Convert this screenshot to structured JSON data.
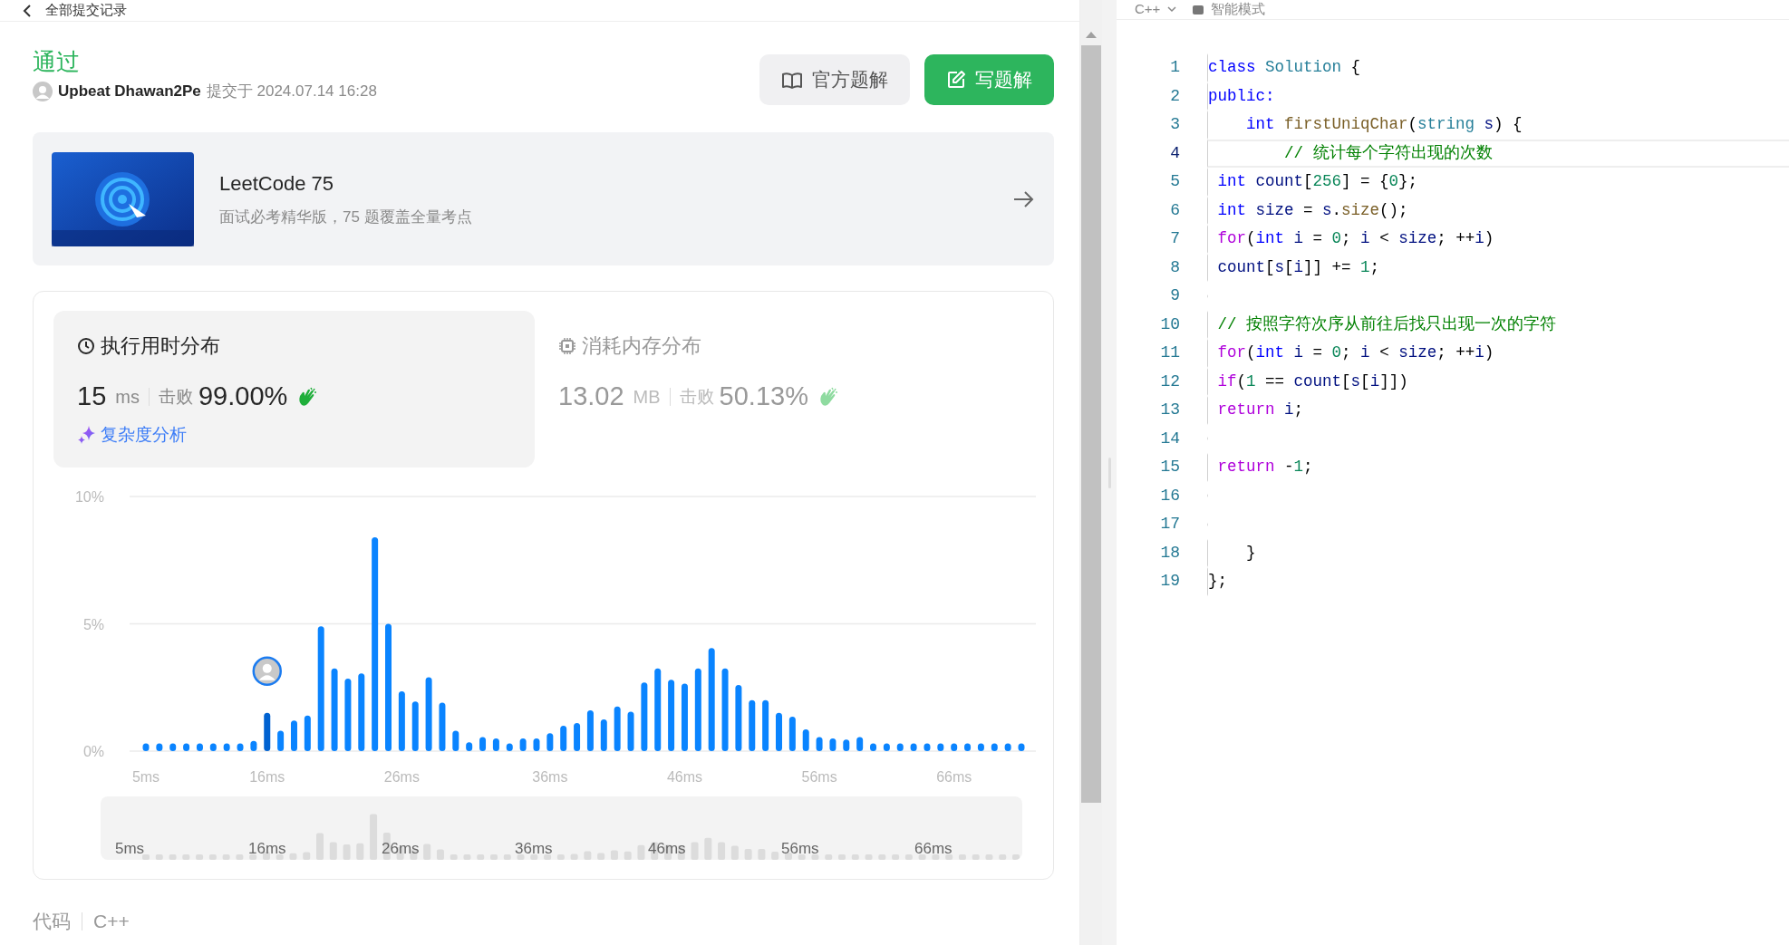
{
  "header": {
    "back_label": "全部提交记录"
  },
  "submission": {
    "status": "通过",
    "user": "Upbeat Dhawan2Pe",
    "submitted_label": "提交于 2024.07.14 16:28"
  },
  "buttons": [
    {
      "label": "官方题解",
      "kind": "secondary"
    },
    {
      "label": "写题解",
      "kind": "primary"
    }
  ],
  "study_plan": {
    "title": "LeetCode 75",
    "subtitle": "面试必考精华版，75 题覆盖全量考点"
  },
  "stats_tabs": [
    {
      "kind": "time",
      "title": "执行用时分布",
      "value": "15",
      "unit": "ms",
      "beats_label": "击败",
      "beats": "99.00%",
      "selected": true
    },
    {
      "kind": "memory",
      "title": "消耗内存分布",
      "value": "13.02",
      "unit": "MB",
      "beats_label": "击败",
      "beats": "50.13%",
      "selected": false
    }
  ],
  "analysis_link": "复杂度分析",
  "chart_data": {
    "type": "bar",
    "stacked": true,
    "categories": [
      "5ms",
      null,
      null,
      null,
      null,
      null,
      null,
      null,
      null,
      "16ms",
      null,
      null,
      null,
      null,
      null,
      null,
      null,
      null,
      null,
      "26ms",
      null,
      null,
      null,
      null,
      null,
      null,
      null,
      null,
      null,
      null,
      "36ms",
      null,
      null,
      null,
      null,
      null,
      null,
      null,
      null,
      null,
      "46ms",
      null,
      null,
      null,
      null,
      null,
      null,
      null,
      null,
      null,
      "56ms",
      null,
      null,
      null,
      null,
      null,
      null,
      null,
      null,
      null,
      "66ms",
      null,
      null,
      null,
      null,
      null
    ],
    "series": [
      {
        "color": "#0062d1",
        "values": [
          null,
          null,
          null,
          null,
          null,
          null,
          null,
          null,
          null,
          1.5,
          null,
          null,
          null,
          null,
          null,
          null,
          null,
          null,
          null,
          null,
          null,
          null,
          null,
          null,
          null,
          null,
          null,
          null,
          null,
          null,
          null,
          null,
          null,
          null,
          null,
          null,
          null,
          null,
          null,
          null,
          null,
          null,
          null,
          null,
          null,
          null,
          null,
          null,
          null,
          null,
          null,
          null,
          null,
          null,
          null,
          null,
          null,
          null,
          null,
          null,
          null,
          null,
          null,
          null,
          null,
          null
        ]
      },
      {
        "color": "#0a84ff",
        "values": [
          0.3,
          0.3,
          0.3,
          0.3,
          0.3,
          0.3,
          0.3,
          0.3,
          0.4,
          null,
          0.8,
          1.2,
          1.4,
          4.9,
          3.25,
          2.85,
          3.05,
          8.4,
          5.0,
          2.35,
          1.95,
          2.9,
          1.9,
          0.8,
          0.35,
          0.55,
          0.5,
          0.3,
          0.5,
          0.5,
          0.7,
          1.0,
          1.1,
          1.6,
          1.25,
          1.75,
          1.55,
          2.7,
          3.25,
          2.8,
          2.65,
          3.25,
          4.05,
          3.25,
          2.6,
          2.0,
          2.0,
          1.5,
          1.35,
          0.85,
          0.55,
          0.5,
          0.45,
          0.55,
          0.3,
          0.3,
          0.3,
          0.3,
          0.3,
          0.3,
          0.3,
          0.3,
          0.3,
          0.3,
          0.3,
          0.3
        ]
      }
    ],
    "ylim": [
      0,
      10
    ],
    "yticks": [
      {
        "value": 0,
        "label": "0%"
      },
      {
        "value": 5,
        "label": "5%"
      },
      {
        "value": 10,
        "label": "10%"
      }
    ]
  },
  "overview_labels": [
    "5ms",
    "16ms",
    "26ms",
    "36ms",
    "46ms",
    "56ms",
    "66ms"
  ],
  "code_section": {
    "label": "代码",
    "language": "C++"
  },
  "editor": {
    "language": "C++",
    "mode": "智能模式",
    "lines": [
      {
        "number": "1",
        "current": false,
        "tokens": [
          {
            "text": "class ",
            "kind": "kw"
          },
          {
            "text": "Solution",
            "kind": "type"
          },
          {
            "text": " {",
            "kind": "plain"
          }
        ]
      },
      {
        "number": "2",
        "current": false,
        "tokens": [
          {
            "text": "public:",
            "kind": "kw"
          }
        ]
      },
      {
        "number": "3",
        "current": false,
        "tokens": [
          {
            "text": "    int ",
            "kind": "kw"
          },
          {
            "text": "firstUniqChar",
            "kind": "func"
          },
          {
            "text": "(",
            "kind": "plain"
          },
          {
            "text": "string",
            "kind": "type"
          },
          {
            "text": " s",
            "kind": "var"
          },
          {
            "text": ") {",
            "kind": "plain"
          }
        ]
      },
      {
        "number": "4",
        "current": true,
        "tokens": [
          {
            "text": "        // 统计每个字符出现的次数",
            "kind": "comment"
          }
        ]
      },
      {
        "number": "5",
        "current": false,
        "tokens": [
          {
            "text": " int ",
            "kind": "kw"
          },
          {
            "text": "count",
            "kind": "var"
          },
          {
            "text": "[",
            "kind": "plain"
          },
          {
            "text": "256",
            "kind": "num"
          },
          {
            "text": "] = {",
            "kind": "plain"
          },
          {
            "text": "0",
            "kind": "num"
          },
          {
            "text": "};",
            "kind": "plain"
          }
        ]
      },
      {
        "number": "6",
        "current": false,
        "tokens": [
          {
            "text": " int ",
            "kind": "kw"
          },
          {
            "text": "size",
            "kind": "var"
          },
          {
            "text": " = ",
            "kind": "plain"
          },
          {
            "text": "s",
            "kind": "var"
          },
          {
            "text": ".",
            "kind": "plain"
          },
          {
            "text": "size",
            "kind": "func"
          },
          {
            "text": "();",
            "kind": "plain"
          }
        ]
      },
      {
        "number": "7",
        "current": false,
        "tokens": [
          {
            "text": " for",
            "kind": "ctrl"
          },
          {
            "text": "(",
            "kind": "plain"
          },
          {
            "text": "int ",
            "kind": "kw"
          },
          {
            "text": "i",
            "kind": "var"
          },
          {
            "text": " = ",
            "kind": "plain"
          },
          {
            "text": "0",
            "kind": "num"
          },
          {
            "text": "; ",
            "kind": "plain"
          },
          {
            "text": "i",
            "kind": "var"
          },
          {
            "text": " < ",
            "kind": "plain"
          },
          {
            "text": "size",
            "kind": "var"
          },
          {
            "text": "; ++",
            "kind": "plain"
          },
          {
            "text": "i",
            "kind": "var"
          },
          {
            "text": ")",
            "kind": "plain"
          }
        ]
      },
      {
        "number": "8",
        "current": false,
        "tokens": [
          {
            "text": " count",
            "kind": "var"
          },
          {
            "text": "[",
            "kind": "plain"
          },
          {
            "text": "s",
            "kind": "var"
          },
          {
            "text": "[",
            "kind": "plain"
          },
          {
            "text": "i",
            "kind": "var"
          },
          {
            "text": "]] += ",
            "kind": "plain"
          },
          {
            "text": "1",
            "kind": "num"
          },
          {
            "text": ";",
            "kind": "plain"
          }
        ]
      },
      {
        "number": "9",
        "current": false
      },
      {
        "number": "10",
        "current": false,
        "tokens": [
          {
            "text": " // 按照字符次序从前往后找只出现一次的字符",
            "kind": "comment"
          }
        ]
      },
      {
        "number": "11",
        "current": false,
        "tokens": [
          {
            "text": " for",
            "kind": "ctrl"
          },
          {
            "text": "(",
            "kind": "plain"
          },
          {
            "text": "int ",
            "kind": "kw"
          },
          {
            "text": "i",
            "kind": "var"
          },
          {
            "text": " = ",
            "kind": "plain"
          },
          {
            "text": "0",
            "kind": "num"
          },
          {
            "text": "; ",
            "kind": "plain"
          },
          {
            "text": "i",
            "kind": "var"
          },
          {
            "text": " < ",
            "kind": "plain"
          },
          {
            "text": "size",
            "kind": "var"
          },
          {
            "text": "; ++",
            "kind": "plain"
          },
          {
            "text": "i",
            "kind": "var"
          },
          {
            "text": ")",
            "kind": "plain"
          }
        ]
      },
      {
        "number": "12",
        "current": false,
        "tokens": [
          {
            "text": " if",
            "kind": "ctrl"
          },
          {
            "text": "(",
            "kind": "plain"
          },
          {
            "text": "1",
            "kind": "num"
          },
          {
            "text": " == ",
            "kind": "plain"
          },
          {
            "text": "count",
            "kind": "var"
          },
          {
            "text": "[",
            "kind": "plain"
          },
          {
            "text": "s",
            "kind": "var"
          },
          {
            "text": "[",
            "kind": "plain"
          },
          {
            "text": "i",
            "kind": "var"
          },
          {
            "text": "]])",
            "kind": "plain"
          }
        ]
      },
      {
        "number": "13",
        "current": false,
        "tokens": [
          {
            "text": " return ",
            "kind": "ctrl"
          },
          {
            "text": "i",
            "kind": "var"
          },
          {
            "text": ";",
            "kind": "plain"
          }
        ]
      },
      {
        "number": "14",
        "current": false
      },
      {
        "number": "15",
        "current": false,
        "tokens": [
          {
            "text": " return ",
            "kind": "ctrl"
          },
          {
            "text": "-",
            "kind": "plain"
          },
          {
            "text": "1",
            "kind": "num"
          },
          {
            "text": ";",
            "kind": "plain"
          }
        ]
      },
      {
        "number": "16",
        "current": false
      },
      {
        "number": "17",
        "current": false
      },
      {
        "number": "18",
        "current": false,
        "tokens": [
          {
            "text": "    }",
            "kind": "plain"
          }
        ]
      },
      {
        "number": "19",
        "current": false,
        "tokens": [
          {
            "text": "};",
            "kind": "plain"
          }
        ]
      }
    ]
  }
}
